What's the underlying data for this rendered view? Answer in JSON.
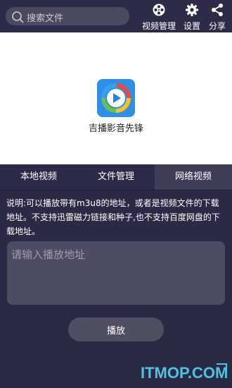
{
  "search": {
    "placeholder": "搜索文件",
    "icon": "search-icon"
  },
  "toolbar": {
    "video_manage": "视频管理",
    "settings": "设置",
    "share": "分享"
  },
  "app": {
    "name": "吉播影音先锋"
  },
  "tabs": [
    {
      "label": "本地视频",
      "active": false
    },
    {
      "label": "文件管理",
      "active": false
    },
    {
      "label": "网络视频",
      "active": true
    }
  ],
  "network": {
    "description": "说明:可以播放带有m3u8的地址，或者是视频文件的下载地址。不支持迅雷磁力链接和种子,也不支持百度网盘的下载地址。",
    "url_placeholder": "请输入播放地址",
    "play_label": "播放"
  },
  "watermark": "ITMOP.COM",
  "colors": {
    "background": "#2a2a44",
    "input": "#4d4d62",
    "active_tab": "#3d3d58"
  }
}
